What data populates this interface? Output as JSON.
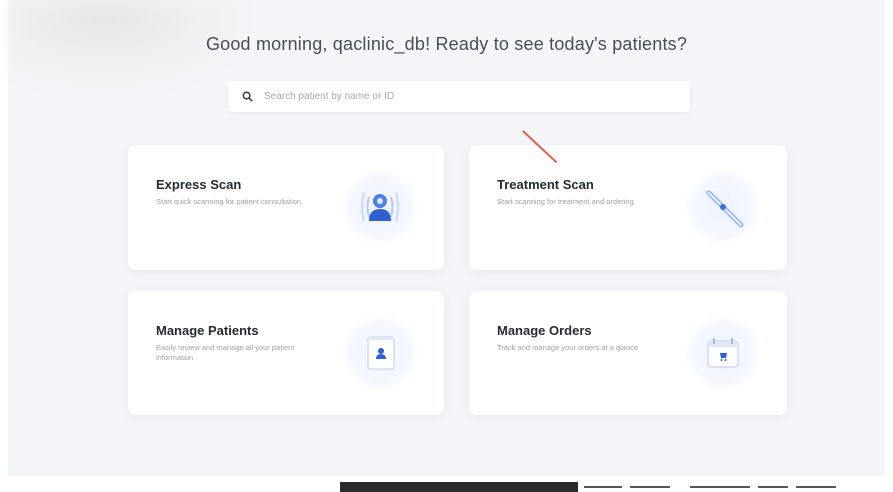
{
  "greeting": {
    "text": "Good morning, qaclinic_db! Ready to see today's patients?"
  },
  "search": {
    "placeholder": "Search patient by name or ID",
    "value": ""
  },
  "cards": [
    {
      "title": "Express Scan",
      "description": "Start quick scanning for patient consultation",
      "icon": "person-scan-icon"
    },
    {
      "title": "Treatment Scan",
      "description": "Start scanning for treatment and ordering",
      "icon": "scanner-wand-icon"
    },
    {
      "title": "Manage Patients",
      "description": "Easily review and manage all your patient information",
      "icon": "patient-folder-icon"
    },
    {
      "title": "Manage Orders",
      "description": "Track and manage your orders at a glance",
      "icon": "order-calendar-icon"
    }
  ],
  "colors": {
    "accent": "#3b6fe0",
    "accent_light": "#eef3ff",
    "panel_bg": "#f3f5f8",
    "annotation": "#e05a4a"
  }
}
